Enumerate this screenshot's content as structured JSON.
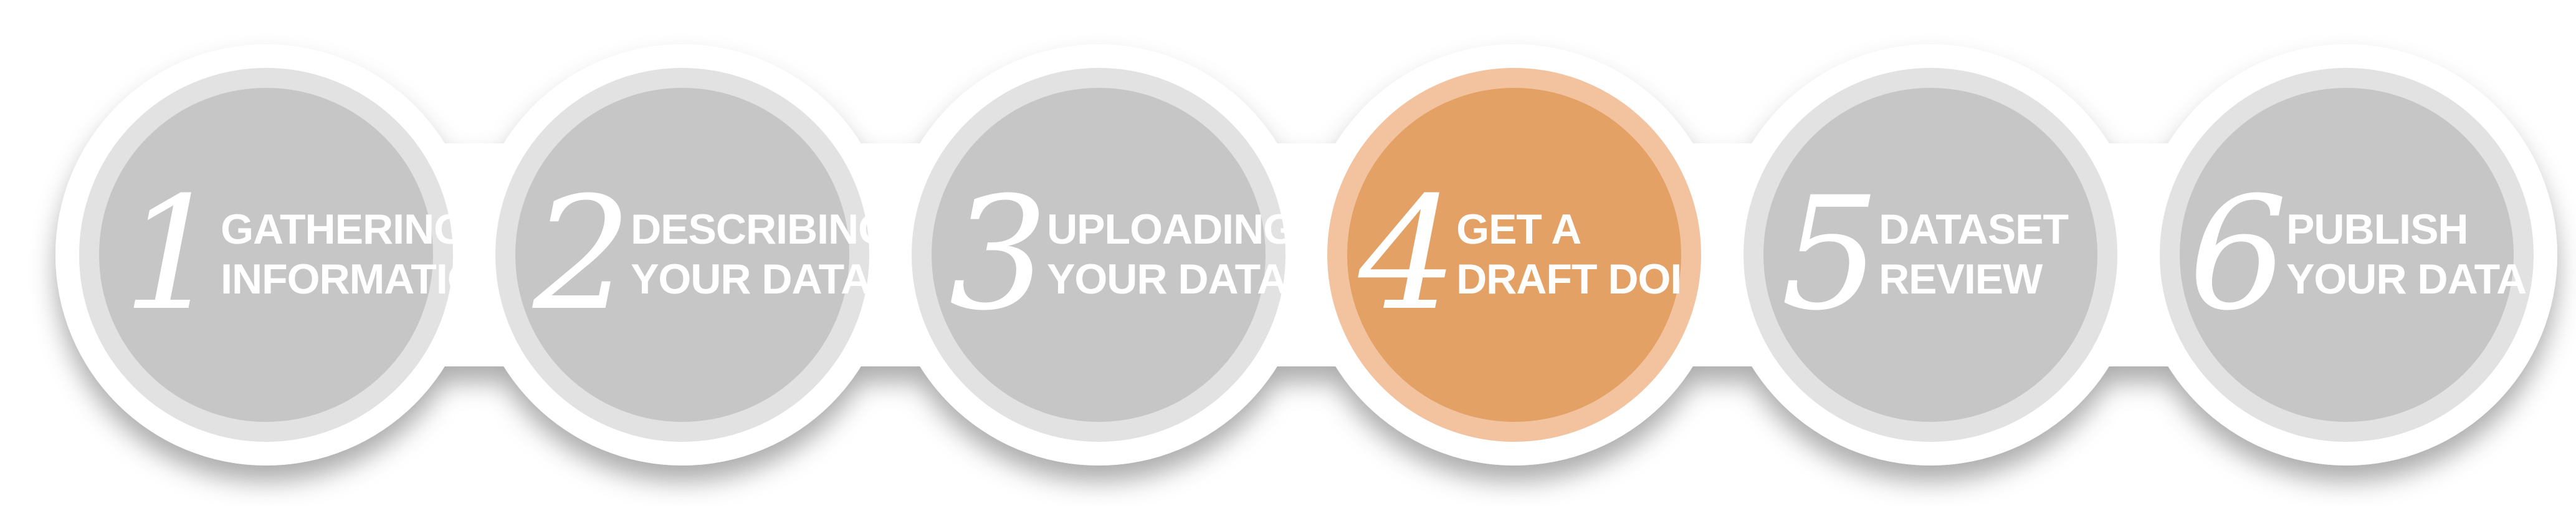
{
  "colors": {
    "background": "#ffffff",
    "frame": "#ffffff",
    "ring": "#e2e2e2",
    "circle": "#c6c6c6",
    "active_ring": "#f2c39e",
    "active_circle": "#e3a166",
    "text": "#ffffff"
  },
  "steps": [
    {
      "number": "1",
      "line1": "GATHERING",
      "line2": "INFORMATION",
      "active": false
    },
    {
      "number": "2",
      "line1": "DESCRIBING",
      "line2": "YOUR DATA",
      "active": false
    },
    {
      "number": "3",
      "line1": "UPLOADING",
      "line2": "YOUR DATA",
      "active": false
    },
    {
      "number": "4",
      "line1": "GET A",
      "line2": "DRAFT DOI",
      "active": true
    },
    {
      "number": "5",
      "line1": "DATASET",
      "line2": "REVIEW",
      "active": false
    },
    {
      "number": "6",
      "line1": "PUBLISH",
      "line2": "YOUR DATA",
      "active": false
    }
  ]
}
